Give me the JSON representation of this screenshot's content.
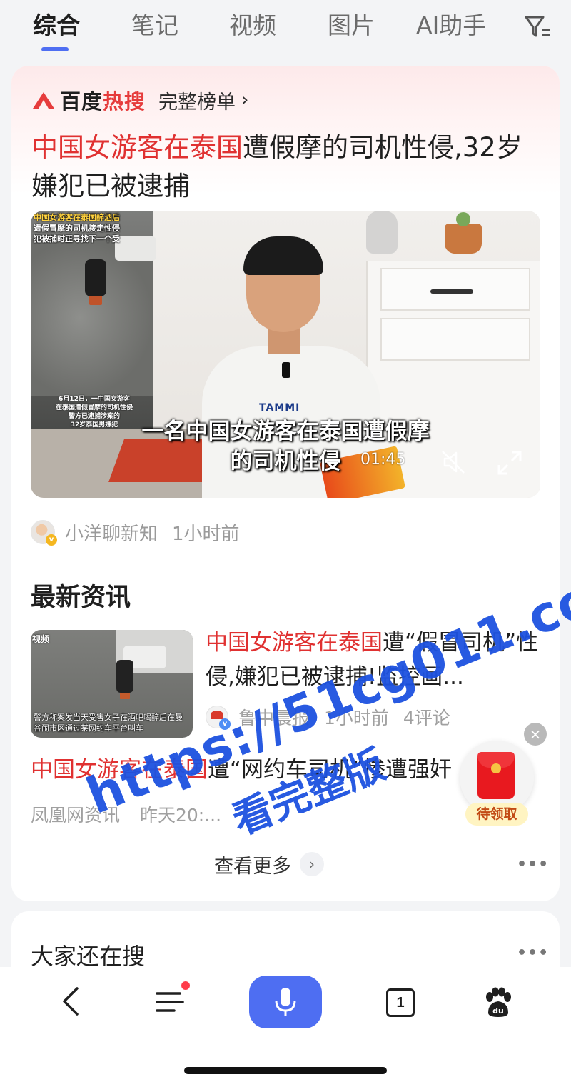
{
  "tabs": {
    "items": [
      "综合",
      "笔记",
      "视频",
      "图片",
      "AI助手"
    ],
    "active_index": 0,
    "filter_icon": "filter-icon"
  },
  "hot": {
    "brand_prefix": "百度",
    "brand_suffix": "热搜",
    "full_list_label": "完整榜单",
    "chevron": "›",
    "headline_highlight": "中国女游客在泰国",
    "headline_rest": "遭假摩的司机性侵,32岁嫌犯已被逮捕"
  },
  "video": {
    "inset_caption_line1": "中国女游客在泰国醉酒后",
    "inset_caption_line2": "遭假冒摩的司机接走性侵",
    "inset_caption_line3": "犯被捕时正寻找下一个受",
    "inset_bottom_line1": "6月12日，一中国女游客",
    "inset_bottom_line2": "在泰国遭假冒摩的司机性侵",
    "inset_bottom_line3": "警方已逮捕涉案的",
    "inset_bottom_line4": "32岁泰国男嫌犯",
    "shirt_text": "TAMMI",
    "subtitle_line1": "一名中国女游客在泰国遭假摩",
    "subtitle_line2": "的司机性侵",
    "duration": "01:45"
  },
  "author": {
    "name": "小洋聊新知",
    "time": "1小时前"
  },
  "latest": {
    "section_title": "最新资讯",
    "news1": {
      "title_highlight": "中国女游客在泰国",
      "title_rest": "遭“假冒司机”性侵,嫌犯已被逮捕!监控画...",
      "thumb_tag": "视频",
      "thumb_caption": "警方称案发当天受害女子在酒吧喝醉后在曼谷闹市区通过某网约车平台叫车",
      "source": "鲁中晨报",
      "time": "1小时前",
      "comments": "4评论"
    },
    "news2": {
      "title_highlight": "中国女游客在泰国",
      "title_rest": "遭“网约车司机”惨遭强奸",
      "source": "凤凰网资讯",
      "time": "昨天20:..."
    },
    "see_more": "查看更多",
    "more_dots": "•••"
  },
  "also_search": {
    "title": "大家还在搜",
    "more_dots": "•••"
  },
  "packet": {
    "label": "待领取",
    "close": "×"
  },
  "watermark": {
    "line1": "https://51cg011.com",
    "line2": "看完整版"
  },
  "bottom_bar": {
    "tab_count": "1",
    "has_notification": true
  },
  "colors": {
    "accent": "#4e6ef2",
    "highlight_red": "#e03131",
    "watermark_blue": "#1d52e0"
  }
}
